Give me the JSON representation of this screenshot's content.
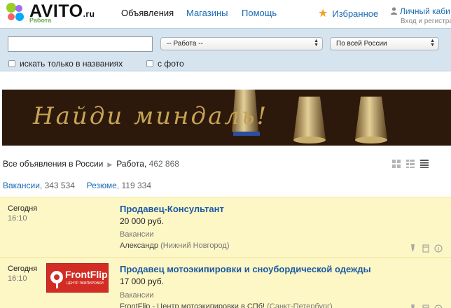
{
  "header": {
    "logo_text": "AVITO",
    "logo_suffix": ".ru",
    "logo_sub": "Работа",
    "nav": [
      {
        "label": "Объявления",
        "active": true
      },
      {
        "label": "Магазины",
        "active": false
      },
      {
        "label": "Помощь",
        "active": false
      }
    ],
    "favorites_label": "Избранное",
    "account_label": "Личный каби",
    "account_sub": "Вход и регистра"
  },
  "search": {
    "query": "",
    "category_select": "-- Работа --",
    "region_select": "По всей России",
    "titles_only_label": "искать только в названиях",
    "with_photo_label": "с фото"
  },
  "banner": {
    "text": "Найди миндаль!"
  },
  "breadcrumb": {
    "root": "Все объявления в России",
    "current": "Работа",
    "count": "462 868"
  },
  "categories": [
    {
      "label": "Вакансии",
      "count": "343 534"
    },
    {
      "label": "Резюме",
      "count": "119 334"
    }
  ],
  "listings": [
    {
      "date": "Сегодня",
      "time": "16:10",
      "title": "Продавец-Консультант",
      "price": "20 000 руб.",
      "category": "Вакансии",
      "seller": "Александр",
      "location": "(Нижний Новгород)",
      "has_logo": false
    },
    {
      "date": "Сегодня",
      "time": "16:10",
      "title": "Продавец мотоэкипировки и сноубордической одежды",
      "price": "17 000 руб.",
      "category": "Вакансии",
      "seller": "FrontFlip - Центр мотоэкипировки в СПб!",
      "location": "(Санкт-Петербург)",
      "has_logo": true,
      "logo_text": "FrontFlip",
      "logo_sub": "ЦЕНТР ЭКИПИРОВКИ"
    }
  ],
  "colors": {
    "link": "#1b6ab3",
    "highlight_row": "#fdf6c5",
    "search_panel": "#d6e4ef",
    "brand_green": "#6aa84f"
  }
}
